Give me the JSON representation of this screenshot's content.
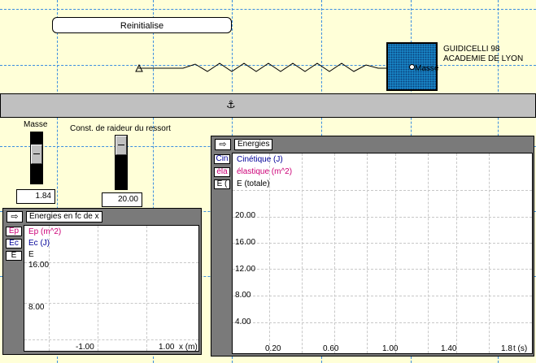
{
  "reset_button": "Reinitialise",
  "credit": {
    "line1": "GUIDICELLI 98",
    "line2": "ACADEMIE DE LYON"
  },
  "mass_label": "Masse",
  "anchor_glyph": "⚓",
  "sliders": {
    "masse": {
      "label": "Masse",
      "value": "1.84"
    },
    "raideur": {
      "label": "Const. de raideur du ressort",
      "value": "20.00"
    }
  },
  "panel_x": {
    "title": "Energies en fc de x",
    "arrow_glyph": "⇨",
    "legend": [
      {
        "short": "Ep",
        "label": "Ep (m^2)",
        "color": "#cc0077"
      },
      {
        "short": "Ec",
        "label": "Ec (J)",
        "color": "#000099"
      },
      {
        "short": "E",
        "label": "E",
        "color": "#000000"
      }
    ],
    "y_ticks": [
      "16.00",
      "8.00"
    ],
    "x_ticks": [
      "-1.00",
      "1.00"
    ],
    "x_label": "x (m)"
  },
  "panel_t": {
    "title": "Energies",
    "arrow_glyph": "⇨",
    "legend": [
      {
        "short": "Cin",
        "label": "Cinétique (J)",
        "color": "#000099"
      },
      {
        "short": "éla",
        "label": "élastique (m^2)",
        "color": "#cc0077"
      },
      {
        "short": "E (",
        "label": "E (totale)",
        "color": "#000000"
      }
    ],
    "y_ticks": [
      "20.00",
      "16.00",
      "12.00",
      "8.00",
      "4.00"
    ],
    "x_ticks": [
      "0.20",
      "0.60",
      "1.00",
      "1.40",
      "1.8"
    ],
    "x_label": "t (s)"
  },
  "colors": {
    "background": "#ffffd8",
    "grid": "#3b8ee0",
    "mass": "#1a8fd0",
    "floor": "#c0c0c0",
    "panel": "#7a7a7a"
  }
}
